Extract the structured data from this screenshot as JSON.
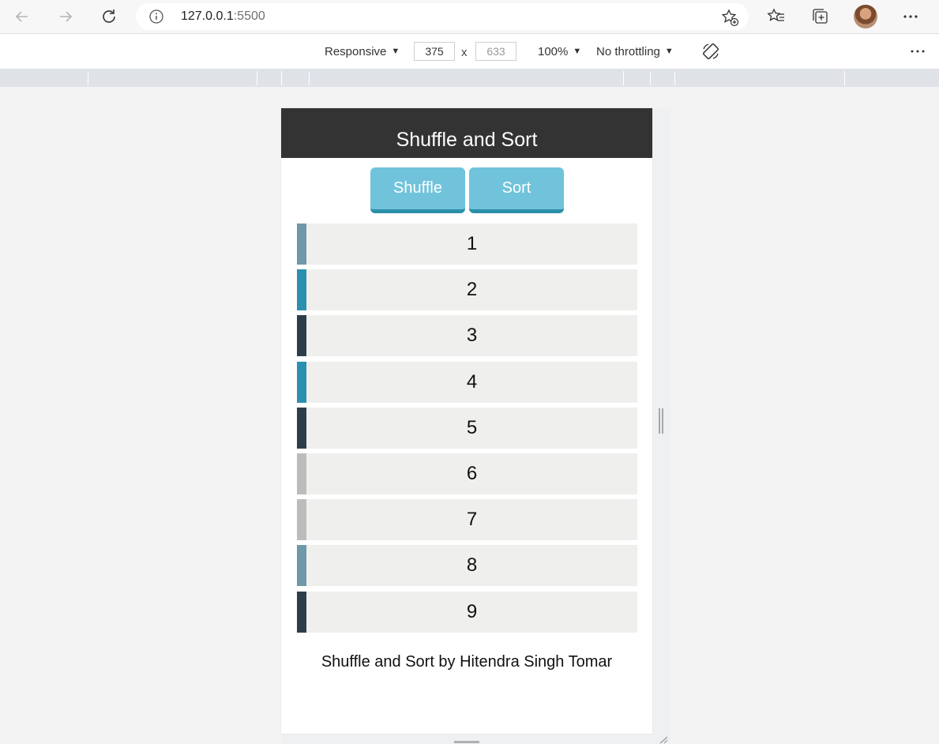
{
  "browser": {
    "url_host": "127.0.0.1",
    "url_port": ":5500"
  },
  "devtools": {
    "device": "Responsive",
    "width": "375",
    "height": "633",
    "times": "x",
    "zoom": "100%",
    "throttling": "No throttling"
  },
  "app": {
    "title": "Shuffle and Sort",
    "shuffle_label": "Shuffle",
    "sort_label": "Sort",
    "items": [
      {
        "label": "1",
        "color": "#6f98a8"
      },
      {
        "label": "2",
        "color": "#2b8fb0"
      },
      {
        "label": "3",
        "color": "#2d3e4a"
      },
      {
        "label": "4",
        "color": "#2b8fb0"
      },
      {
        "label": "5",
        "color": "#2d3e4a"
      },
      {
        "label": "6",
        "color": "#bcbcbc"
      },
      {
        "label": "7",
        "color": "#bcbcbc"
      },
      {
        "label": "8",
        "color": "#6f98a8"
      },
      {
        "label": "9",
        "color": "#2d3e4a"
      }
    ],
    "footer": "Shuffle and Sort by Hitendra Singh Tomar"
  }
}
